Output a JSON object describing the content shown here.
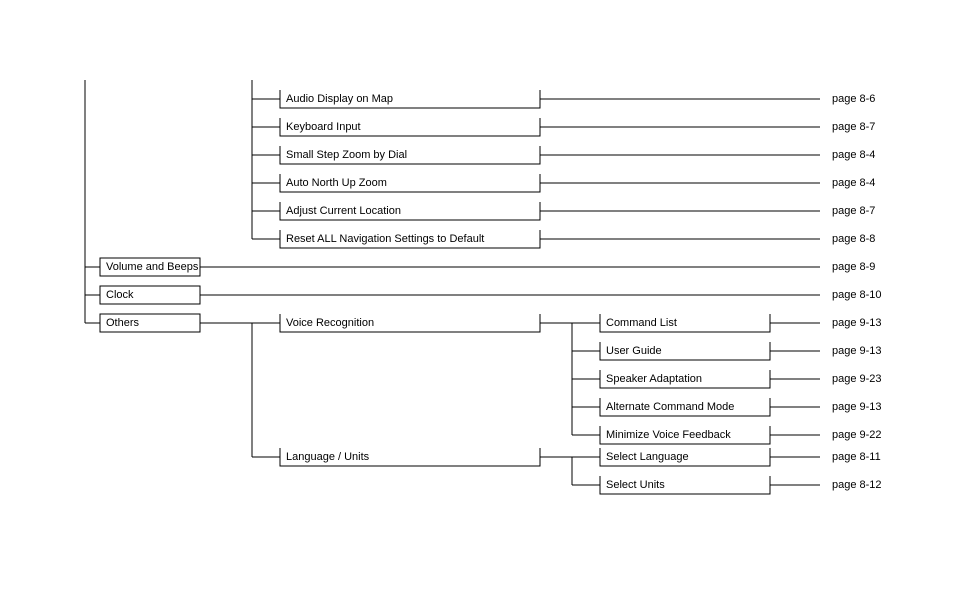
{
  "level1": {
    "volume_beeps": {
      "label": "Volume and Beeps",
      "page": "page 8-9"
    },
    "clock": {
      "label": "Clock",
      "page": "page 8-10"
    },
    "others": {
      "label": "Others"
    }
  },
  "nav_settings": [
    {
      "label": "Audio Display on Map",
      "page": "page 8-6"
    },
    {
      "label": "Keyboard Input",
      "page": "page 8-7"
    },
    {
      "label": "Small Step Zoom by Dial",
      "page": "page 8-4"
    },
    {
      "label": "Auto North Up Zoom",
      "page": "page 8-4"
    },
    {
      "label": "Adjust Current Location",
      "page": "page 8-7"
    },
    {
      "label": "Reset ALL Navigation Settings to Default",
      "page": "page 8-8"
    }
  ],
  "others_children": {
    "voice_recognition": {
      "label": "Voice Recognition"
    },
    "language_units": {
      "label": "Language / Units"
    }
  },
  "voice_recognition_items": [
    {
      "label": "Command List",
      "page": "page 9-13"
    },
    {
      "label": "User Guide",
      "page": "page 9-13"
    },
    {
      "label": "Speaker Adaptation",
      "page": "page 9-23"
    },
    {
      "label": "Alternate Command Mode",
      "page": "page 9-13"
    },
    {
      "label": "Minimize Voice Feedback",
      "page": "page 9-22"
    }
  ],
  "language_units_items": [
    {
      "label": "Select Language",
      "page": "page 8-11"
    },
    {
      "label": "Select Units",
      "page": "page 8-12"
    }
  ]
}
